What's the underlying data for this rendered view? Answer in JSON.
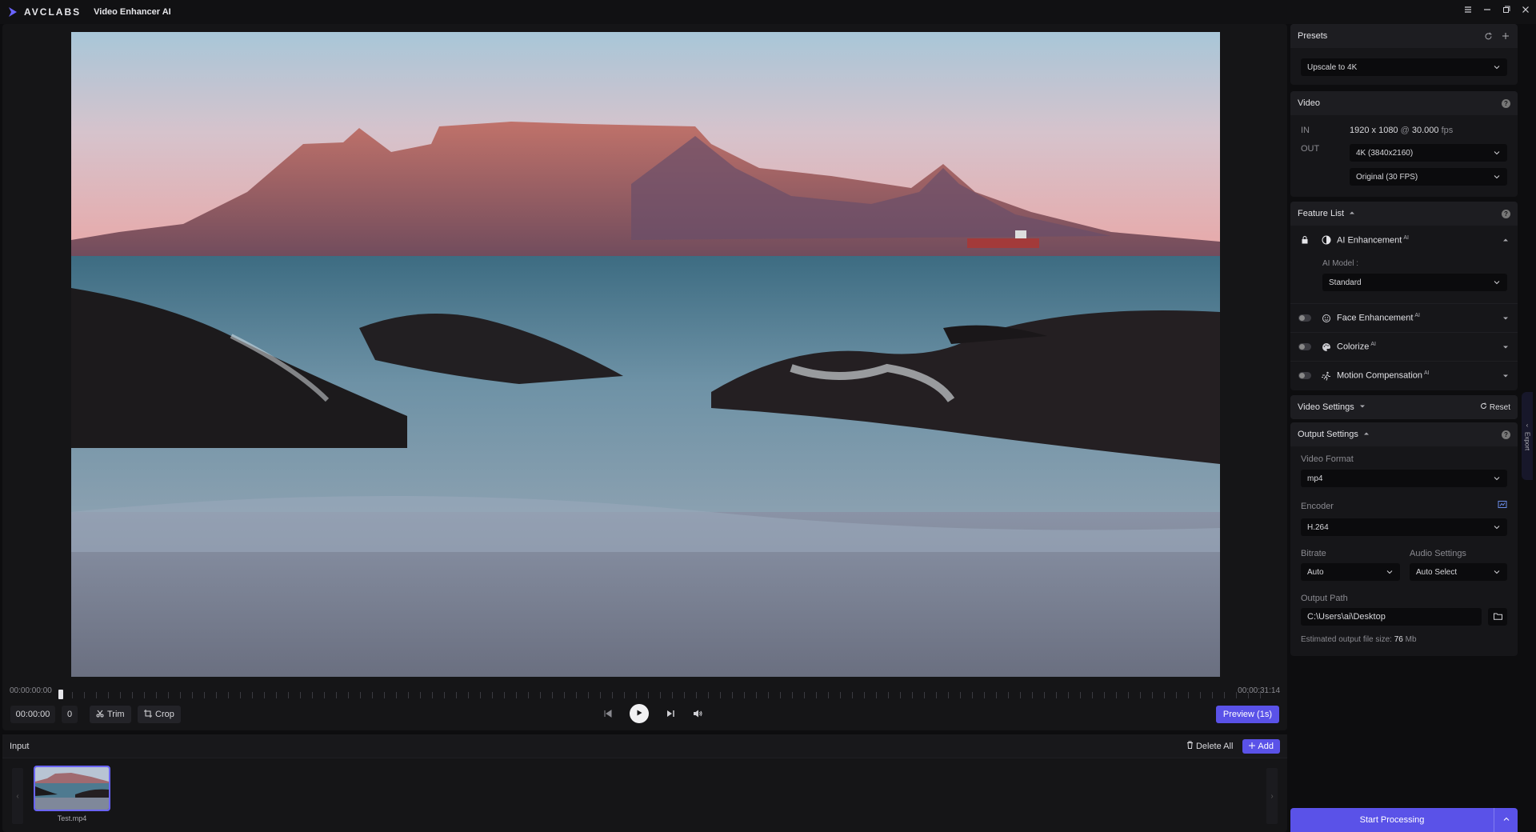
{
  "app": {
    "logo_text": "AVCLABS",
    "name": "Video Enhancer AI",
    "accent": "#5a52e8"
  },
  "window_controls": [
    "menu-icon",
    "minimize-icon",
    "maximize-icon",
    "close-icon"
  ],
  "player": {
    "time_start": "00:00:00:00",
    "time_end": "00:00:31:14",
    "current_time": "00:00:00",
    "frame": "0",
    "trim_label": "Trim",
    "crop_label": "Crop",
    "preview_label": "Preview (1s)"
  },
  "input": {
    "title": "Input",
    "delete_all": "Delete All",
    "add": "Add",
    "files": [
      {
        "name": "Test.mp4"
      }
    ]
  },
  "presets": {
    "title": "Presets",
    "selected": "Upscale to 4K"
  },
  "video": {
    "title": "Video",
    "in_label": "IN",
    "in_res": "1920 x 1080",
    "at": "@",
    "in_fps": "30.000",
    "fps_unit": "fps",
    "out_label": "OUT",
    "out_res": "4K (3840x2160)",
    "out_fps": "Original (30 FPS)"
  },
  "feature_list": {
    "title": "Feature List",
    "ai_badge": "AI",
    "ai_enhancement": "AI Enhancement",
    "ai_model_label": "AI Model :",
    "ai_model": "Standard",
    "face_enhancement": "Face Enhancement",
    "colorize": "Colorize",
    "motion_compensation": "Motion Compensation"
  },
  "video_settings": {
    "title": "Video Settings",
    "reset": "Reset"
  },
  "output_settings": {
    "title": "Output Settings",
    "format_label": "Video Format",
    "format": "mp4",
    "encoder_label": "Encoder",
    "encoder": "H.264",
    "bitrate_label": "Bitrate",
    "bitrate": "Auto",
    "audio_label": "Audio Settings",
    "audio": "Auto Select",
    "path_label": "Output Path",
    "path": "C:\\Users\\ai\\Desktop",
    "size_label": "Estimated output file size:",
    "size_value": "76",
    "size_unit": "Mb"
  },
  "start_processing": "Start Processing",
  "export_tab": "Export"
}
